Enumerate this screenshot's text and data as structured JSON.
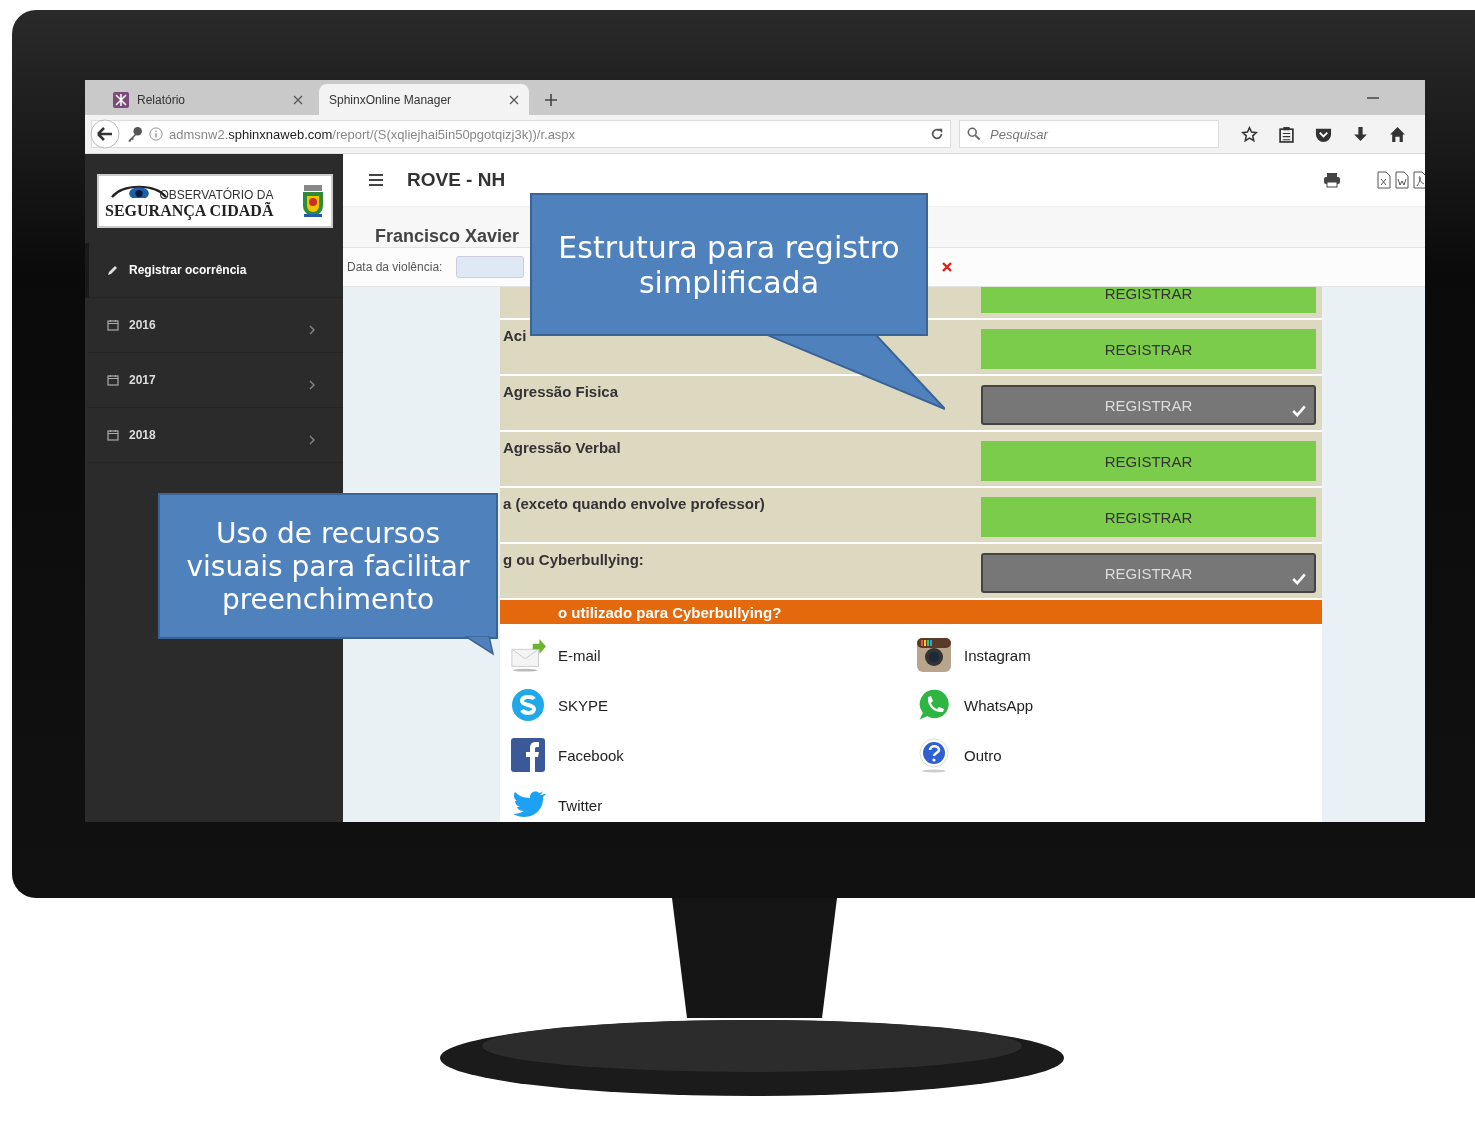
{
  "browser": {
    "tabs": [
      {
        "label": "Relatório",
        "selected": false
      },
      {
        "label": "SphinxOnline Manager",
        "selected": true
      }
    ],
    "address": {
      "prefix": "admsnw2.",
      "host": "sphinxnaweb.com",
      "path": "/report/(S(xqliejhai5in50pgotqizj3k))/r.aspx"
    },
    "search": {
      "placeholder": "Pesquisar"
    }
  },
  "sidebar": {
    "logo": {
      "line_1": "OBSERVATÓRIO DA",
      "line_2": "SEGURANÇA CIDADÃ"
    },
    "items": [
      {
        "label": "Registrar ocorrência",
        "kind": "action",
        "selected": true
      },
      {
        "label": "2016",
        "kind": "year",
        "selected": false
      },
      {
        "label": "2017",
        "kind": "year",
        "selected": false
      },
      {
        "label": "2018",
        "kind": "year",
        "selected": false
      }
    ]
  },
  "header": {
    "title": "ROVE - NH"
  },
  "form": {
    "student": "Francisco Xavier",
    "date_label": "Data da violência:",
    "questions": [
      {
        "button": "REGISTRAR",
        "selected": false
      },
      {
        "label": "Aci",
        "button": "REGISTRAR",
        "selected": false
      },
      {
        "label": "Agressão Fisica",
        "button": "REGISTRAR",
        "selected": true
      },
      {
        "label": "Agressão Verbal",
        "button": "REGISTRAR",
        "selected": false
      },
      {
        "label": "a (exceto quando envolve professor)",
        "button": "REGISTRAR",
        "selected": false
      },
      {
        "label": "g ou Cyberbullying:",
        "button": "REGISTRAR",
        "selected": true
      }
    ],
    "section": "o utilizado para Cyberbullying?",
    "options": [
      {
        "label": "E-mail"
      },
      {
        "label": "Instagram"
      },
      {
        "label": "SKYPE"
      },
      {
        "label": "WhatsApp"
      },
      {
        "label": "Facebook"
      },
      {
        "label": "Outro"
      },
      {
        "label": "Twitter"
      }
    ]
  },
  "callouts": [
    "Estrutura para registro simplificada",
    "Uso de recursos visuais para facilitar preenchimento"
  ]
}
